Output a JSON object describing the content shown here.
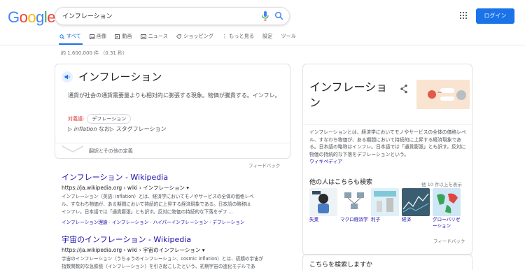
{
  "logo": {
    "letters": [
      "G",
      "o",
      "o",
      "g",
      "l",
      "e"
    ],
    "colors": [
      "#4285F4",
      "#EA4335",
      "#FBBC05",
      "#4285F4",
      "#34A853",
      "#EA4335"
    ]
  },
  "search": {
    "query": "インフレーション"
  },
  "header": {
    "login_label": "ログイン",
    "accent": "#1a73e8"
  },
  "tabs": [
    {
      "label": "すべて",
      "icon": "search-icon"
    },
    {
      "label": "画像",
      "icon": "image-icon"
    },
    {
      "label": "動画",
      "icon": "video-icon"
    },
    {
      "label": "ニュース",
      "icon": "news-icon"
    },
    {
      "label": "ショッピング",
      "icon": "tag-icon"
    },
    {
      "label": "もっと見る",
      "icon": "more-vert-icon"
    },
    {
      "label": "設定",
      "icon": ""
    },
    {
      "label": "ツール",
      "icon": ""
    }
  ],
  "stats": "約 1,600,000 件 （0.31 秒）",
  "definition": {
    "word": "インフレーション",
    "body": "通貨が社会の通貨需要量よりも相対的に膨張する現象。物価が騰貴する。インフレ。",
    "antonym_label": "対義語:",
    "antonym": "デフレーション",
    "inflection_prefix": "▷ ",
    "inflection_italic": "inflation",
    "inflection_rest": " なお▷ スタグフレーション",
    "translate_label": "翻訳とその他の定義",
    "feedback": "フィードバック"
  },
  "results": [
    {
      "title": "インフレーション - Wikipedia",
      "url": "https://ja.wikipedia.org › wiki › インフレーション ▾",
      "snippet": [
        "インフレーション（英語: inflation）とは、経済学においてモノやサービスの全体の価格レベ",
        "ル、すなわち物価が、ある期間において持続的に上昇する経済現象である。日本語の略称は",
        "インフレ。日本語では「通貨膨張」とも訳す。反対に物価の持続的な下落をデフ ..."
      ],
      "links": "インフレーション理論 · インフレーション · ハイパーインフレーション · デフレーション"
    },
    {
      "title": "宇宙のインフレーション - Wikipedia",
      "url": "https://ja.wikipedia.org › wiki › 宇宙のインフレーション ▾",
      "snippet": [
        "宇宙のインフレーション（うちゅうのインフレーション、cosmic inflation）とは、初期の宇宙が",
        "指数関数的な急膨張（インフレーション）を引き起こしたという、初期宇宙の進化モデルであ"
      ]
    }
  ],
  "knowledge_panel": {
    "title": "インフレーション",
    "description": "インフレーションとは、経済学においてモノやサービスの全体の価格レベル、すなわち物価が、ある期間において持続的に上昇する経済現象である。日本語の略称はインフレ。日本語では「通貨膨張」とも訳す。反対に物価の持続的な下落をデフレーションという。",
    "source": "ウィキペディア",
    "people_also_search": "他の人はこちらも検索",
    "view_more": "他 10 件以上を表示",
    "items": [
      {
        "label": "失業",
        "icon": "unemployment-image"
      },
      {
        "label": "マクロ経済学",
        "icon": "macroeconomics-image"
      },
      {
        "label": "利子",
        "icon": "interest-image"
      },
      {
        "label": "経済",
        "icon": "economy-image"
      },
      {
        "label": "グローバリゼーション",
        "icon": "globalization-image"
      }
    ],
    "feedback": "フィードバック"
  },
  "related": {
    "title": "こちらを検索しますか"
  }
}
